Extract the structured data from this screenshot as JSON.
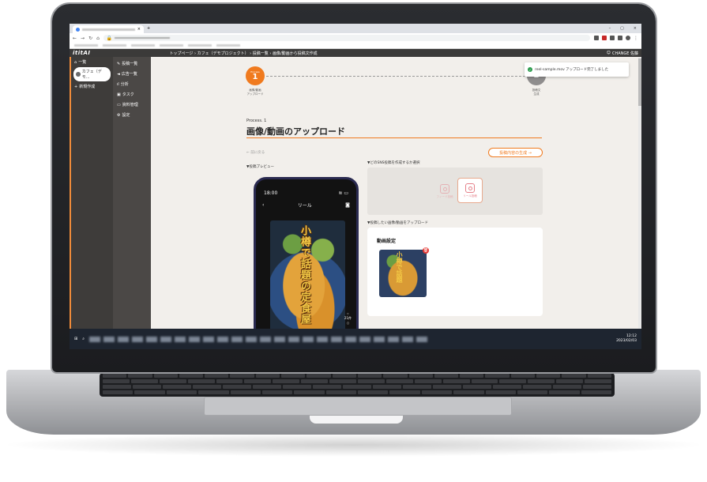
{
  "app": {
    "logo": "ititAI",
    "breadcrumb": "トップページ › カフェ（デモプロジェクト） › 投稿一覧 › 画像/動画から投稿文作成",
    "user": "CHANGE 佐藤"
  },
  "sidebar1": {
    "items": [
      {
        "label": "一覧",
        "icon": "home-icon"
      },
      {
        "label": "カフェ（デモ...",
        "icon": "avatar"
      },
      {
        "label": "新規作成",
        "icon": "plus-icon"
      }
    ]
  },
  "sidebar2": {
    "items": [
      {
        "label": "投稿一覧",
        "icon": "edit-icon"
      },
      {
        "label": "広告一覧",
        "icon": "megaphone-icon"
      },
      {
        "label": "分析",
        "icon": "chart-icon"
      },
      {
        "label": "タスク",
        "icon": "task-icon"
      },
      {
        "label": "資料管理",
        "icon": "folder-icon"
      },
      {
        "label": "設定",
        "icon": "gear-icon"
      }
    ]
  },
  "stepper": {
    "step1": {
      "tag": "Process",
      "num": "1",
      "label": "画像/動画\nアップロード"
    },
    "step2": {
      "num": "2",
      "label": "投稿文\n生成"
    }
  },
  "process": {
    "kicker": "Process. 1",
    "title": "画像/動画のアップロード",
    "back": "← 前に戻る",
    "generate": "投稿内容の生成 →"
  },
  "preview": {
    "label": "▼投稿プレビュー",
    "time": "18:00",
    "header": "リール",
    "overlay": "小樽で話題の定食屋",
    "side_label": "21件"
  },
  "sns": {
    "label": "▼どのSNS投稿を作成するか選択",
    "opt1": "フィード投稿",
    "opt2": "リール投稿"
  },
  "upload": {
    "label": "▼投稿したい画像/動画をアップロード",
    "title": "動画設定",
    "thumb_text": "小樽で話題"
  },
  "toast": {
    "message": "reel-sample.mov アップロード完了しました"
  },
  "taskbar": {
    "time": "12:12",
    "date": "2023/02/03"
  },
  "colors": {
    "accent": "#f07a1e",
    "sidebar": "#3e3c3a",
    "success": "#2e9d4f"
  }
}
